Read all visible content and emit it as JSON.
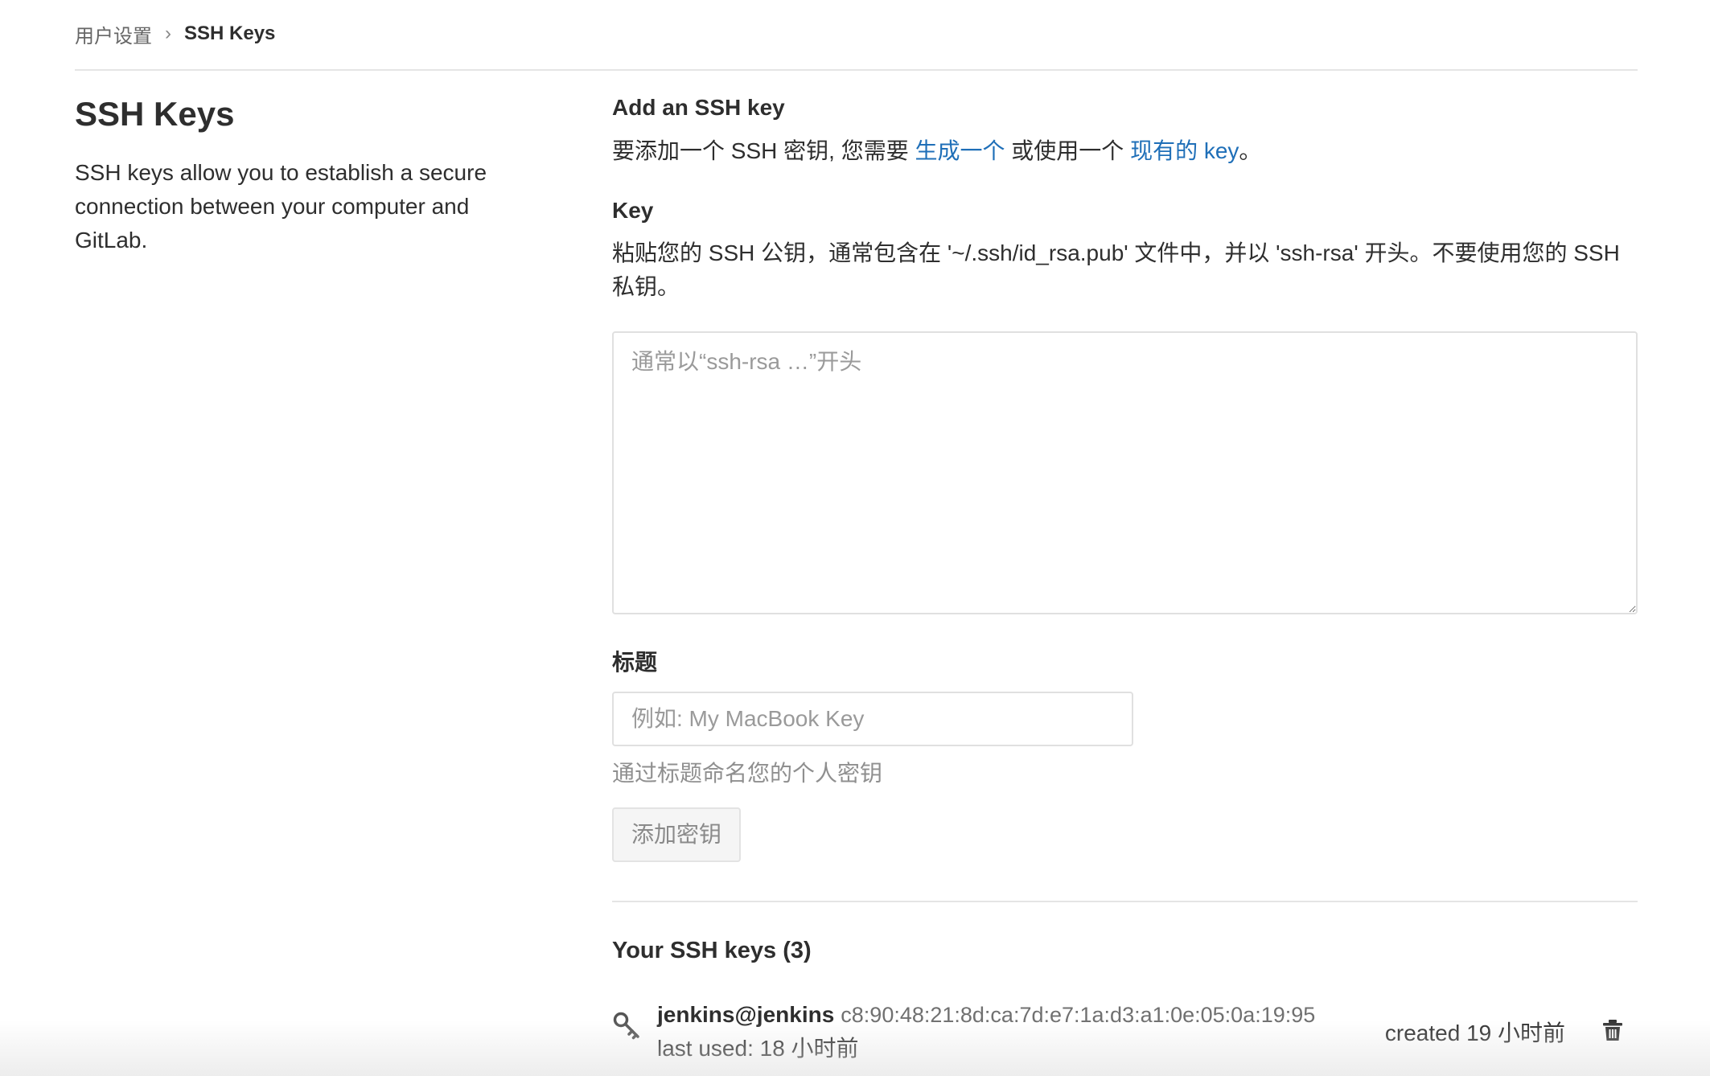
{
  "breadcrumb": {
    "parent": "用户设置",
    "separator": "›",
    "current": "SSH Keys"
  },
  "sidebar": {
    "title": "SSH Keys",
    "description": "SSH keys allow you to establish a secure connection between your computer and GitLab."
  },
  "form": {
    "heading": "Add an SSH key",
    "intro_prefix": "要添加一个 SSH 密钥, 您需要 ",
    "intro_link1": "生成一个",
    "intro_middle": " 或使用一个 ",
    "intro_link2": "现有的 key",
    "intro_suffix": "。",
    "key_label": "Key",
    "key_help": "粘贴您的 SSH 公钥，通常包含在 '~/.ssh/id_rsa.pub' 文件中，并以 'ssh-rsa' 开头。不要使用您的 SSH 私钥。",
    "key_placeholder": "通常以“ssh-rsa …”开头",
    "key_value": "",
    "title_label": "标题",
    "title_placeholder": "例如: My MacBook Key",
    "title_value": "",
    "title_help": "通过标题命名您的个人密钥",
    "submit_label": "添加密钥"
  },
  "keys": {
    "heading": "Your SSH keys (3)",
    "items": [
      {
        "user": "jenkins@jenkins",
        "fingerprint": "c8:90:48:21:8d:ca:7d:e7:1a:d3:a1:0e:05:0a:19:95",
        "last_used": "last used: 18 小时前",
        "created": "created 19 小时前",
        "icon": "key-icon",
        "delete_icon": "trash-icon"
      }
    ]
  },
  "colors": {
    "link": "#1f6fb8",
    "text": "#2e2e2e",
    "muted": "#8f8f8f",
    "border": "#e0e0e0"
  }
}
